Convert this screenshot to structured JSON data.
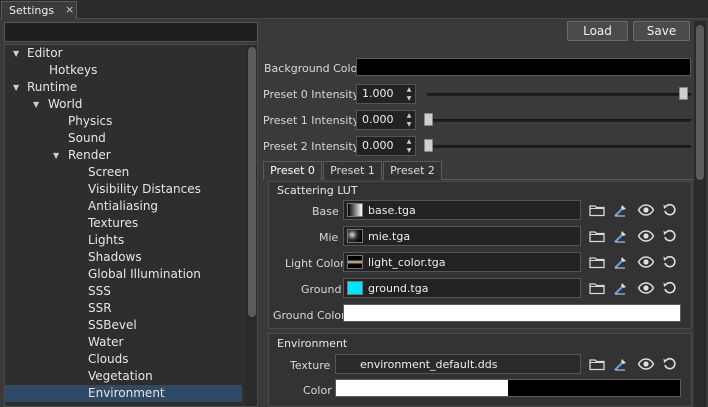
{
  "window": {
    "tab_title": "Settings",
    "close_glyph": "×"
  },
  "search": {
    "value": "",
    "placeholder": ""
  },
  "tree": {
    "items": [
      {
        "label": "Editor",
        "expanded": true
      },
      {
        "label": "Hotkeys"
      },
      {
        "label": "Runtime",
        "expanded": true
      },
      {
        "label": "World",
        "expanded": true
      },
      {
        "label": "Physics"
      },
      {
        "label": "Sound"
      },
      {
        "label": "Render",
        "expanded": true
      },
      {
        "label": "Screen"
      },
      {
        "label": "Visibility Distances"
      },
      {
        "label": "Antialiasing"
      },
      {
        "label": "Textures"
      },
      {
        "label": "Lights"
      },
      {
        "label": "Shadows"
      },
      {
        "label": "Global Illumination"
      },
      {
        "label": "SSS"
      },
      {
        "label": "SSR"
      },
      {
        "label": "SSBevel"
      },
      {
        "label": "Water"
      },
      {
        "label": "Clouds"
      },
      {
        "label": "Vegetation"
      },
      {
        "label": "Environment",
        "selected": true
      }
    ]
  },
  "toolbar": {
    "load_label": "Load",
    "save_label": "Save"
  },
  "props": {
    "background_color_label": "Background Color",
    "background_color": "#000000",
    "preset0_label": "Preset 0 Intensity",
    "preset0_value": "1.000",
    "preset0_level": 1.0,
    "preset1_label": "Preset 1 Intensity",
    "preset1_value": "0.000",
    "preset1_level": 0.0,
    "preset2_label": "Preset 2 Intensity",
    "preset2_value": "0.000",
    "preset2_level": 0.0
  },
  "preset_tabs": [
    "Preset 0",
    "Preset 1",
    "Preset 2"
  ],
  "scattering": {
    "title": "Scattering LUT",
    "base_label": "Base",
    "base_file": "base.tga",
    "mie_label": "Mie",
    "mie_file": "mie.tga",
    "light_label": "Light Color",
    "light_file": "light_color.tga",
    "ground_label": "Ground",
    "ground_file": "ground.tga",
    "ground_color_label": "Ground Color",
    "ground_color": "#ffffff"
  },
  "environment": {
    "title": "Environment",
    "texture_label": "Texture",
    "texture_file": "environment_default.dds",
    "color_label": "Color"
  },
  "icons": {
    "folder": "folder-icon",
    "pick": "pick-icon",
    "view": "eye-icon",
    "reset": "reset-icon"
  },
  "colors": {
    "selection": "#2e4a66",
    "ground_thumb": "#00e5ff"
  }
}
